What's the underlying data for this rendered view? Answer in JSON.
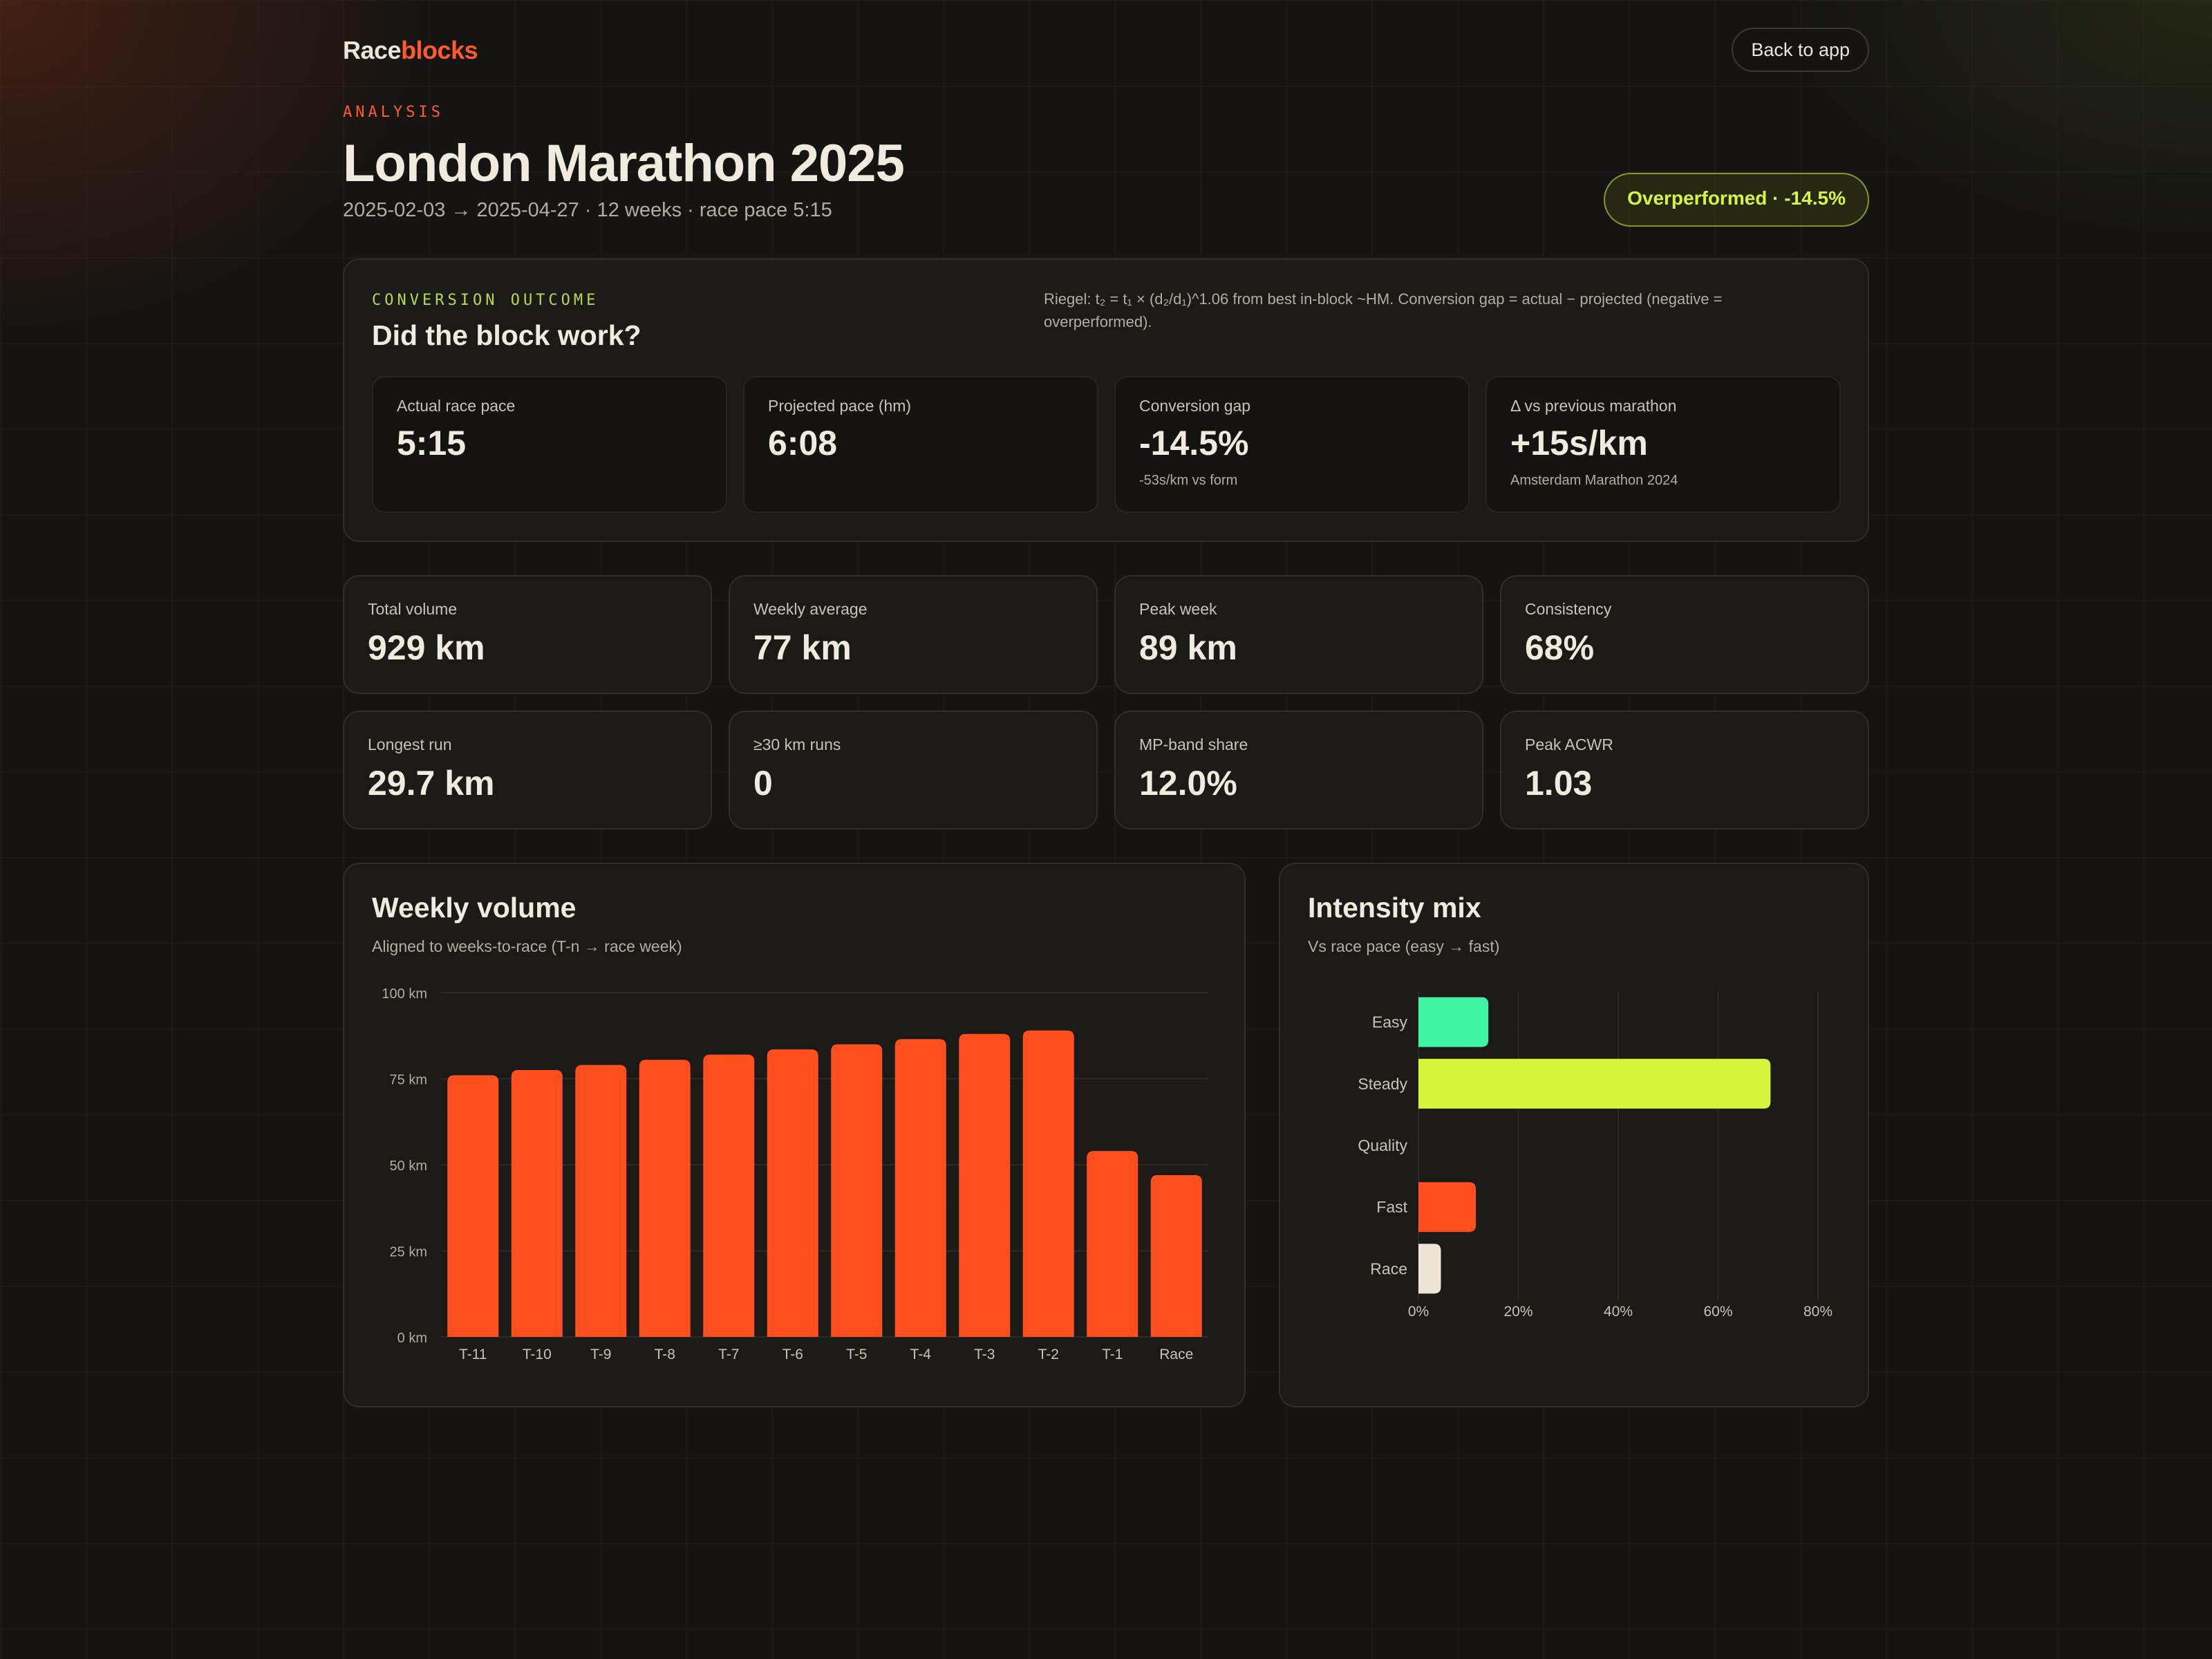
{
  "header": {
    "logo_part1": "Race",
    "logo_part2": "blocks",
    "back_label": "Back to app",
    "eyebrow": "ANALYSIS",
    "title": "London Marathon 2025",
    "subtitle": "2025-02-03 → 2025-04-27 · 12 weeks · race pace 5:15",
    "badge": "Overperformed · -14.5%"
  },
  "conversion": {
    "eyebrow": "CONVERSION OUTCOME",
    "title": "Did the block work?",
    "note": "Riegel: t₂ = t₁ × (d₂/d₁)^1.06 from best in-block ~HM. Conversion gap = actual − projected (negative = overperformed).",
    "kpis": [
      {
        "label": "Actual race pace",
        "value": "5:15",
        "sub": ""
      },
      {
        "label": "Projected pace (hm)",
        "value": "6:08",
        "sub": ""
      },
      {
        "label": "Conversion gap",
        "value": "-14.5%",
        "sub": "-53s/km vs form"
      },
      {
        "label": "Δ vs previous marathon",
        "value": "+15s/km",
        "sub": "Amsterdam Marathon 2024"
      }
    ]
  },
  "stats": [
    {
      "label": "Total volume",
      "value": "929 km"
    },
    {
      "label": "Weekly average",
      "value": "77 km"
    },
    {
      "label": "Peak week",
      "value": "89 km"
    },
    {
      "label": "Consistency",
      "value": "68%"
    },
    {
      "label": "Longest run",
      "value": "29.7 km"
    },
    {
      "label": "≥30 km runs",
      "value": "0"
    },
    {
      "label": "MP-band share",
      "value": "12.0%"
    },
    {
      "label": "Peak ACWR",
      "value": "1.03"
    }
  ],
  "weekly_chart": {
    "title": "Weekly volume",
    "subtitle": "Aligned to weeks-to-race (T-n → race week)"
  },
  "intensity_chart": {
    "title": "Intensity mix",
    "subtitle": "Vs race pace (easy → fast)"
  },
  "chart_data": [
    {
      "type": "bar",
      "title": "Weekly volume",
      "subtitle": "Aligned to weeks-to-race (T-n → race week)",
      "categories": [
        "T-11",
        "T-10",
        "T-9",
        "T-8",
        "T-7",
        "T-6",
        "T-5",
        "T-4",
        "T-3",
        "T-2",
        "T-1",
        "Race"
      ],
      "values": [
        76,
        77.5,
        79,
        80.5,
        82,
        83.5,
        85,
        86.5,
        88,
        89,
        54,
        47
      ],
      "ylim": [
        0,
        100
      ],
      "yticks": [
        0,
        25,
        50,
        75,
        100
      ],
      "ytick_labels": [
        "0 km",
        "25 km",
        "50 km",
        "75 km",
        "100 km"
      ],
      "grid": true,
      "color": "#ff4f1f"
    },
    {
      "type": "bar",
      "orientation": "horizontal",
      "title": "Intensity mix",
      "subtitle": "Vs race pace (easy → fast)",
      "categories": [
        "Easy",
        "Steady",
        "Quality",
        "Fast",
        "Race"
      ],
      "values": [
        14,
        70.5,
        0,
        11.5,
        4.5
      ],
      "colors": [
        "#3ff5a3",
        "#d8f53e",
        "#777777",
        "#ff4f1f",
        "#ede6d6"
      ],
      "xlim": [
        0,
        80
      ],
      "xticks": [
        0,
        20,
        40,
        60,
        80
      ],
      "xtick_labels": [
        "0%",
        "20%",
        "40%",
        "60%",
        "80%"
      ],
      "grid": true
    }
  ]
}
